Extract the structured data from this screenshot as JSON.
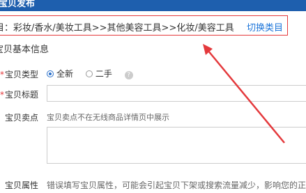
{
  "header": {
    "title": "宝贝发布"
  },
  "category": {
    "path_text": "目：彩妆/香水/美妆工具>>其他美容工具>>化妆/美容工具",
    "switch_label": "切换类目"
  },
  "section": {
    "title": "宝贝基本信息"
  },
  "form": {
    "type": {
      "label": "宝贝类型",
      "required_mark": "*",
      "options": [
        {
          "label": "全新",
          "checked": true
        },
        {
          "label": "二手",
          "checked": false
        }
      ],
      "help_glyph": "?"
    },
    "title": {
      "label": "宝贝标题",
      "required_mark": "*",
      "value": ""
    },
    "selling_point": {
      "label": "宝贝卖点",
      "hint": "宝贝卖点不在无线商品详情页中展示",
      "value": ""
    },
    "attributes": {
      "label": "宝贝属性",
      "hint": "错误填写宝贝属性，可能会引起宝贝下架或搜索流量减少，影响您的正"
    }
  },
  "annotation": {
    "arrow_color": "#e4393c"
  }
}
